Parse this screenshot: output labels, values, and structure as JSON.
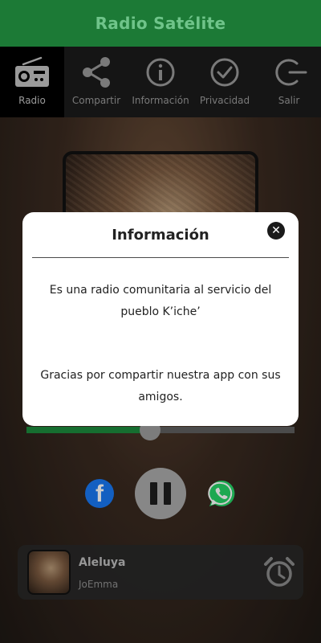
{
  "header": {
    "title": "Radio Satélite"
  },
  "nav": {
    "items": [
      {
        "label": "Radio",
        "icon": "radio-icon",
        "active": true
      },
      {
        "label": "Compartir",
        "icon": "share-icon"
      },
      {
        "label": "Información",
        "icon": "info-icon"
      },
      {
        "label": "Privacidad",
        "icon": "check-circle-icon"
      },
      {
        "label": "Salir",
        "icon": "power-icon"
      }
    ]
  },
  "player": {
    "progress_fraction": 0.46,
    "state": "playing",
    "icons": [
      "facebook-icon",
      "pause-icon",
      "whatsapp-icon"
    ]
  },
  "now_playing": {
    "title": "Aleluya",
    "artist": "JoEmma",
    "alarm_icon": "alarm-clock-icon"
  },
  "dialog": {
    "title": "Información",
    "close_label": "✕",
    "body_lines_1": "Es una radio comunitaria al servicio del pueblo K’iche’",
    "body_lines_2": "Gracias por compartir nuestra app con sus amigos."
  },
  "colors": {
    "brand_green": "#1c7a36",
    "header_text": "#6fc48a",
    "progress_fill": "#1c8a3c",
    "facebook_blue": "#1877f2",
    "whatsapp_green": "#25d366"
  }
}
